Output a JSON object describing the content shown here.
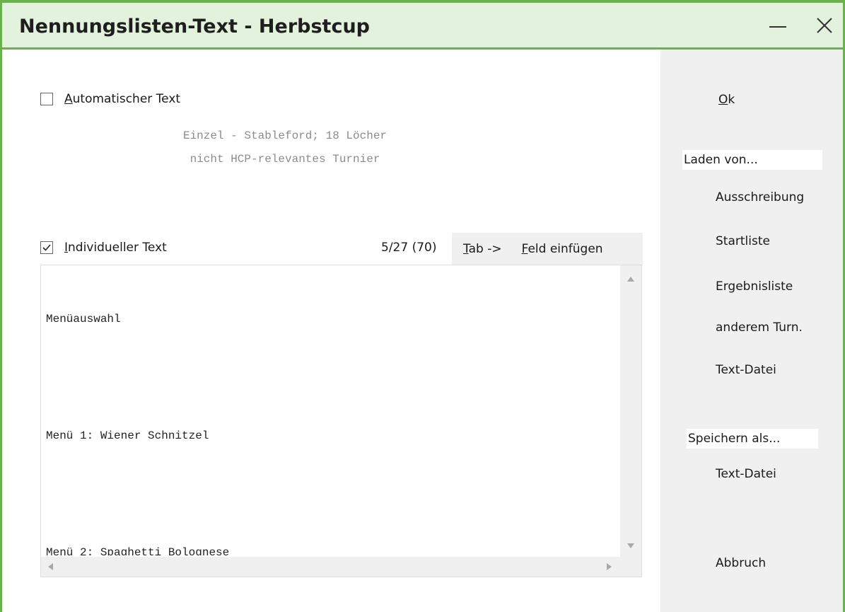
{
  "window": {
    "title": "Nennungslisten-Text - Herbstcup",
    "minimize_label": "—",
    "close_label": "✕"
  },
  "auto_text": {
    "checked": false,
    "label_mnemonic": "A",
    "label_rest": "utomatischer Text",
    "lines": [
      "Einzel - Stableford; 18 Löcher",
      "nicht HCP-relevantes Turnier"
    ]
  },
  "individual_text": {
    "checked": true,
    "label_mnemonic": "I",
    "label_rest": "ndividueller Text",
    "count": "5/27 (70)",
    "tab_mnemonic": "T",
    "tab_rest": "ab ->",
    "field_mnemonic": "F",
    "field_rest": "eld einfügen",
    "content_lines": [
      "Menüauswahl",
      "",
      "Menü 1: Wiener Schnitzel",
      "",
      "Menü 2: Spaghetti Bolognese"
    ]
  },
  "sidebar": {
    "ok_mnemonic": "O",
    "ok_rest": "k",
    "load_header": "Laden von...",
    "load_items": [
      "Ausschreibung",
      "Startliste",
      "Ergebnisliste",
      "anderem Turn.",
      "Text-Datei"
    ],
    "save_header": "Speichern als...",
    "save_items": [
      "Text-Datei"
    ],
    "cancel": "Abbruch"
  },
  "colors": {
    "accent": "#6ab04c",
    "titlebar_bg": "#e3f2dd",
    "panel_bg": "#f0f0f0"
  }
}
